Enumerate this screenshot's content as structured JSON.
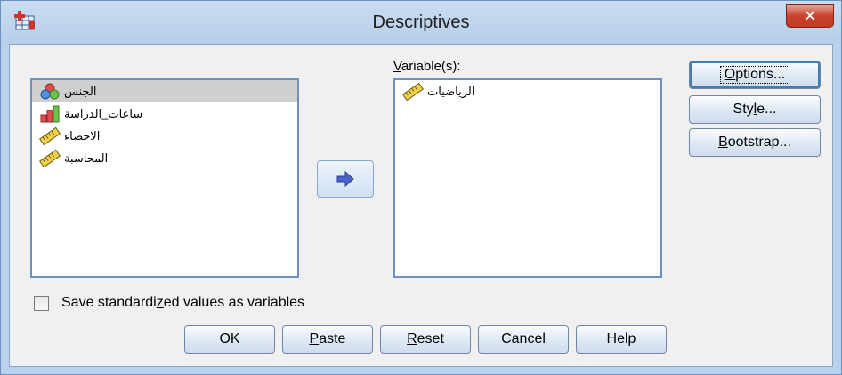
{
  "window": {
    "title": "Descriptives",
    "close_label": "✕"
  },
  "source_list": {
    "items": [
      {
        "label": "الجنس",
        "icon": "nominal-variable-icon",
        "selected": true
      },
      {
        "label": "ساعات_الدراسة",
        "icon": "ordinal-variable-icon",
        "selected": false
      },
      {
        "label": "الاحصاء",
        "icon": "scale-variable-icon",
        "selected": false
      },
      {
        "label": "المحاسبة",
        "icon": "scale-variable-icon",
        "selected": false
      }
    ]
  },
  "target_list": {
    "label_mnemonic": "V",
    "label_rest": "ariable(s):",
    "items": [
      {
        "label": "الرياضيات",
        "icon": "scale-variable-icon"
      }
    ]
  },
  "side_buttons": {
    "options_mnemonic": "O",
    "options_rest": "ptions...",
    "style_prefix": "Sty",
    "style_mnemonic": "l",
    "style_rest": "e...",
    "bootstrap_mnemonic": "B",
    "bootstrap_rest": "ootstrap..."
  },
  "checkbox": {
    "label_prefix": "Save standardi",
    "label_mnemonic": "z",
    "label_rest": "ed values as variables",
    "checked": false
  },
  "bottom_buttons": {
    "ok": "OK",
    "paste_mnemonic": "P",
    "paste_rest": "aste",
    "reset_mnemonic": "R",
    "reset_rest": "eset",
    "cancel": "Cancel",
    "help": "Help"
  },
  "colors": {
    "frame": "#b9d1ea",
    "client": "#f0f0f0",
    "selected_row": "#cfcfcf",
    "close_button": "#c9422c",
    "arrow": "#4a63c9"
  }
}
